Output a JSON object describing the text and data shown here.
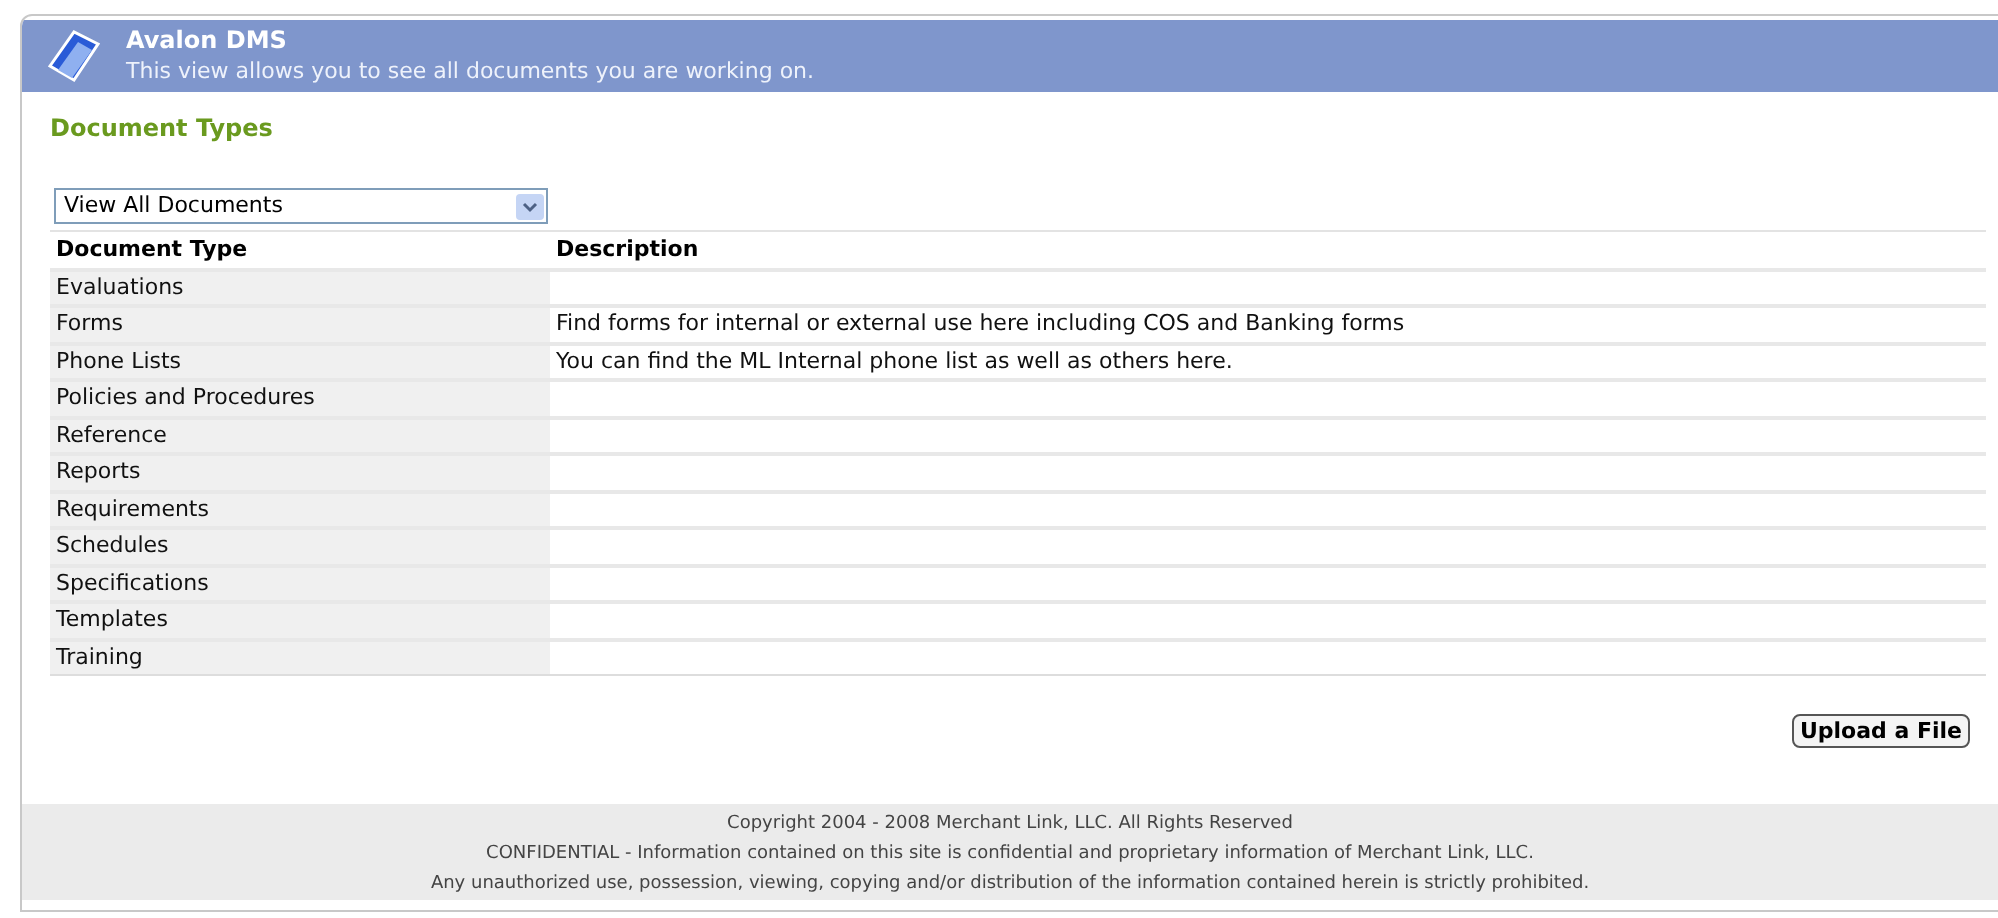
{
  "header": {
    "title": "Avalon DMS",
    "subtitle": "This view allows you to see all documents you are working on."
  },
  "section_title": "Document Types",
  "filter": {
    "value": "View All Documents"
  },
  "table": {
    "columns": [
      "Document Type",
      "Description"
    ],
    "rows": [
      [
        "Evaluations",
        ""
      ],
      [
        "Forms",
        "Find forms for internal or external use here including COS and Banking forms"
      ],
      [
        "Phone Lists",
        "You can find the ML Internal phone list as well as others here."
      ],
      [
        "Policies and Procedures",
        ""
      ],
      [
        "Reference",
        ""
      ],
      [
        "Reports",
        ""
      ],
      [
        "Requirements",
        ""
      ],
      [
        "Schedules",
        ""
      ],
      [
        "Specifications",
        ""
      ],
      [
        "Templates",
        ""
      ],
      [
        "Training",
        ""
      ]
    ]
  },
  "upload_button": "Upload a File",
  "footer": [
    "Copyright 2004 - 2008 Merchant Link, LLC. All Rights Reserved",
    "CONFIDENTIAL - Information contained on this site is confidential and proprietary information of Merchant Link, LLC.",
    "Any unauthorized use, possession, viewing, copying and/or distribution of the information contained herein is strictly prohibited."
  ]
}
